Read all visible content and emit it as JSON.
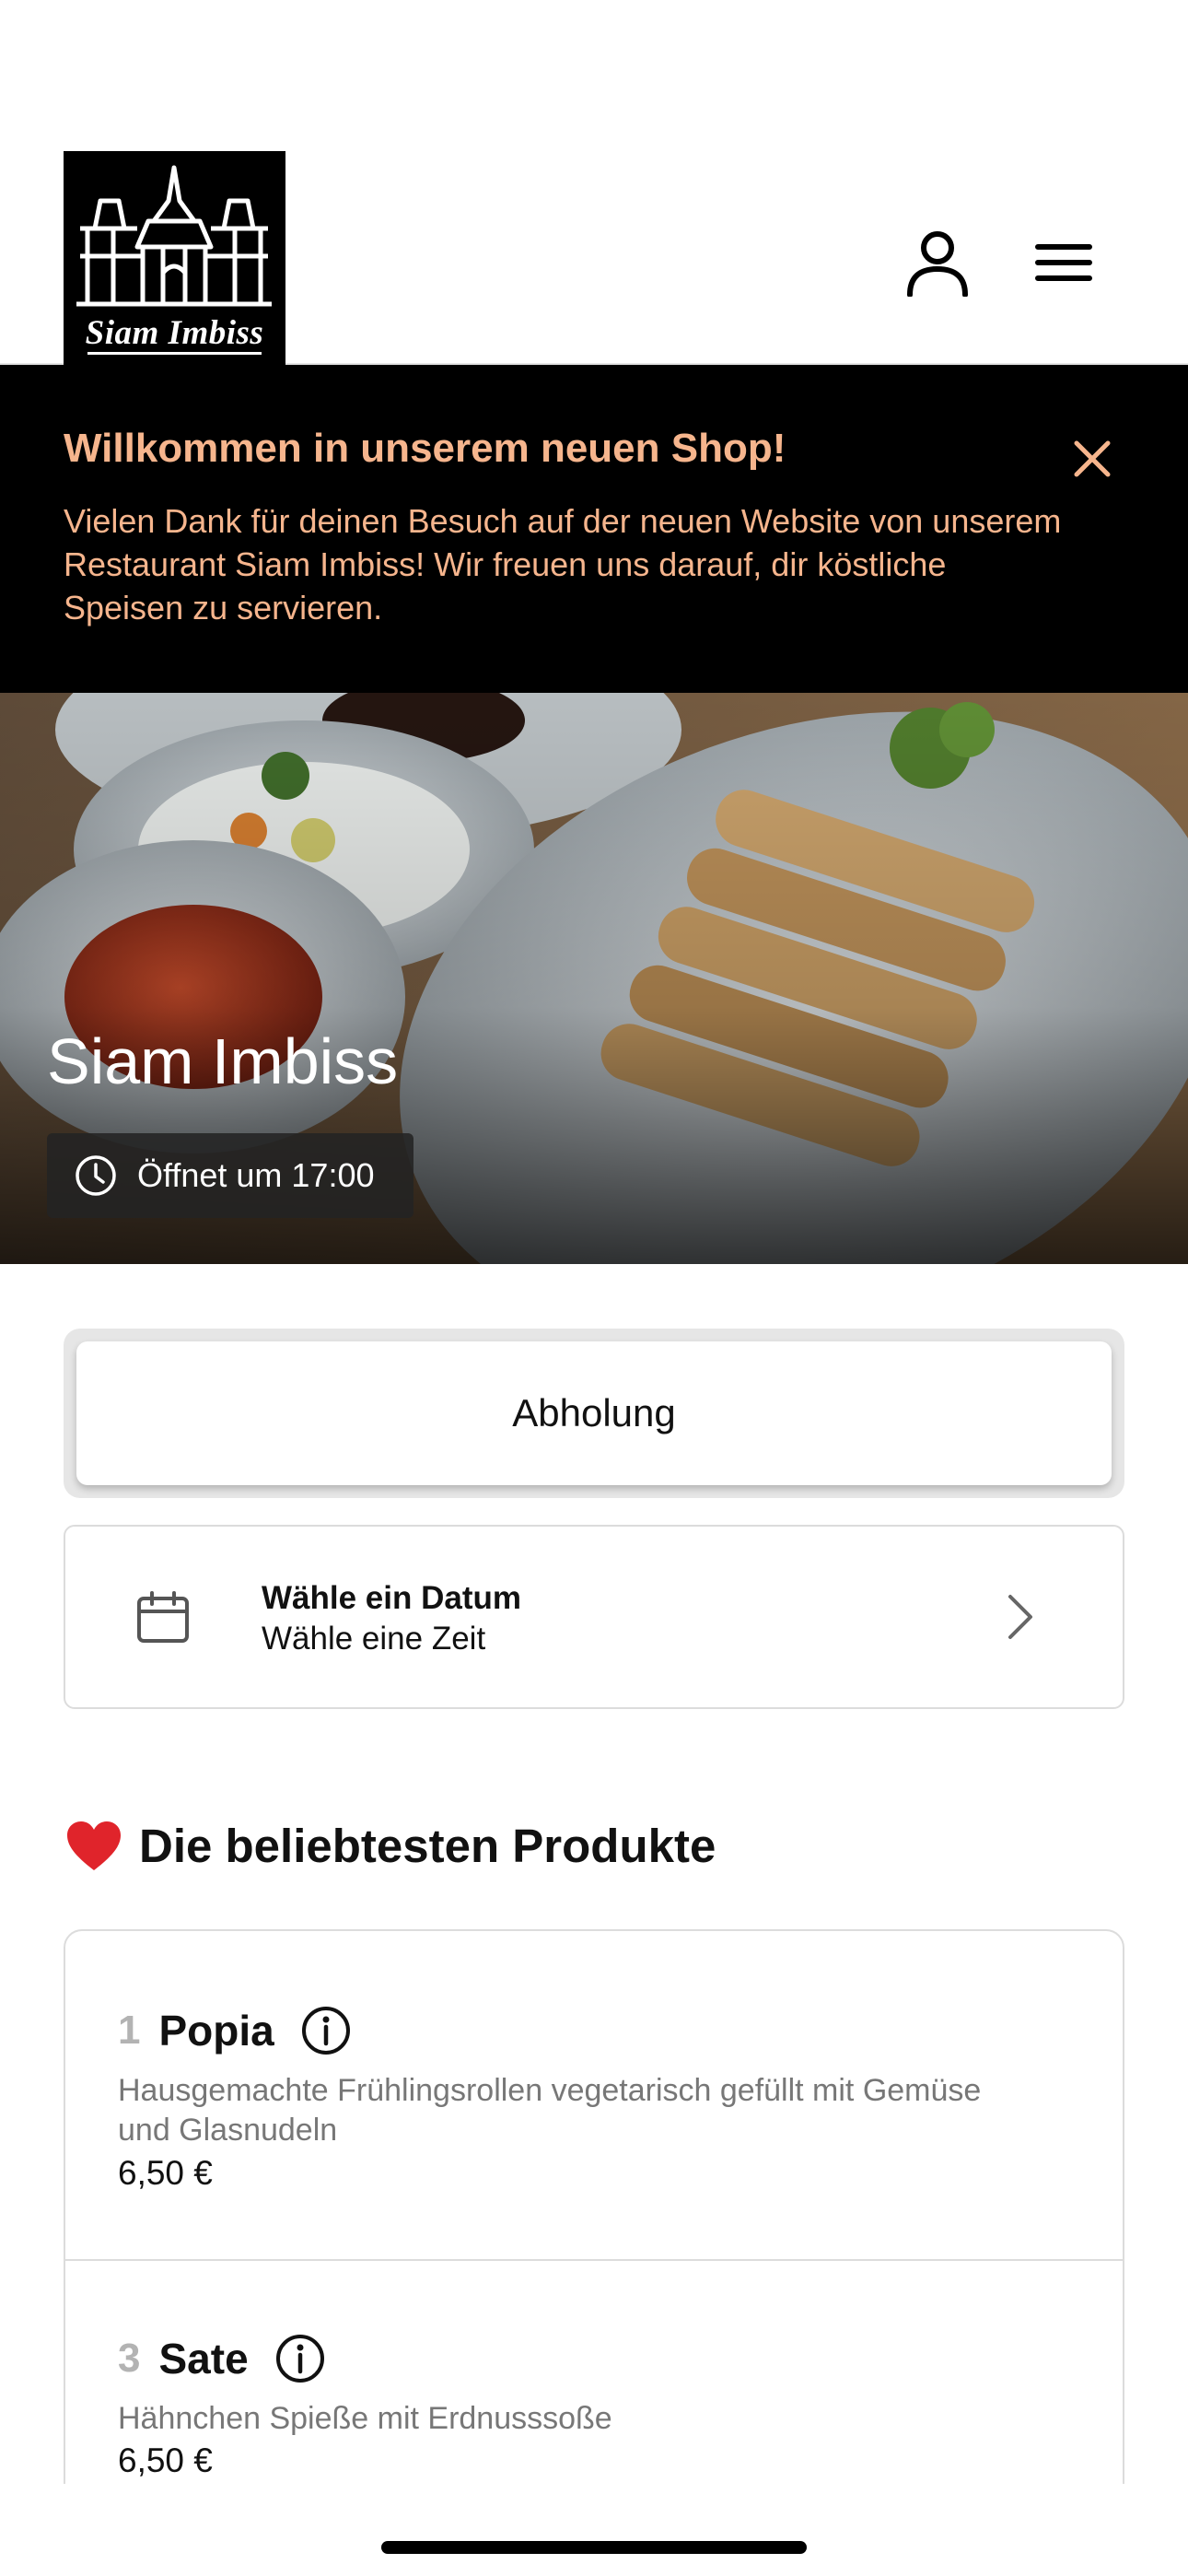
{
  "header": {
    "logo_text": "Siam Imbiss",
    "icons": {
      "user": "user-icon",
      "menu": "menu-icon"
    }
  },
  "banner": {
    "title": "Willkommen in unserem neuen Shop!",
    "text": "Vielen Dank für deinen Besuch auf der neuen Website von unserem Restaurant Siam Imbiss! Wir freuen uns darauf, dir köstliche Speisen zu servieren.",
    "close_icon": "close-icon",
    "text_color": "#f6b58d",
    "background": "#000000"
  },
  "hero": {
    "title": "Siam Imbiss",
    "opening": "Öffnet um 17:00",
    "image_subject": "spring rolls with dipping sauce"
  },
  "order": {
    "mode_label": "Abholung"
  },
  "schedule": {
    "date_label": "Wähle ein Datum",
    "time_label": "Wähle eine Zeit"
  },
  "popular": {
    "title": "Die beliebtesten Produkte",
    "products": [
      {
        "number": "1",
        "name": "Popia",
        "description": "Hausgemachte Frühlingsrollen vegetarisch gefüllt mit Gemüse und Glasnudeln",
        "price": "6,50 €"
      },
      {
        "number": "3",
        "name": "Sate",
        "description": "Hähnchen Spieße mit Erdnusssoße",
        "price": "6,50 €"
      }
    ]
  }
}
